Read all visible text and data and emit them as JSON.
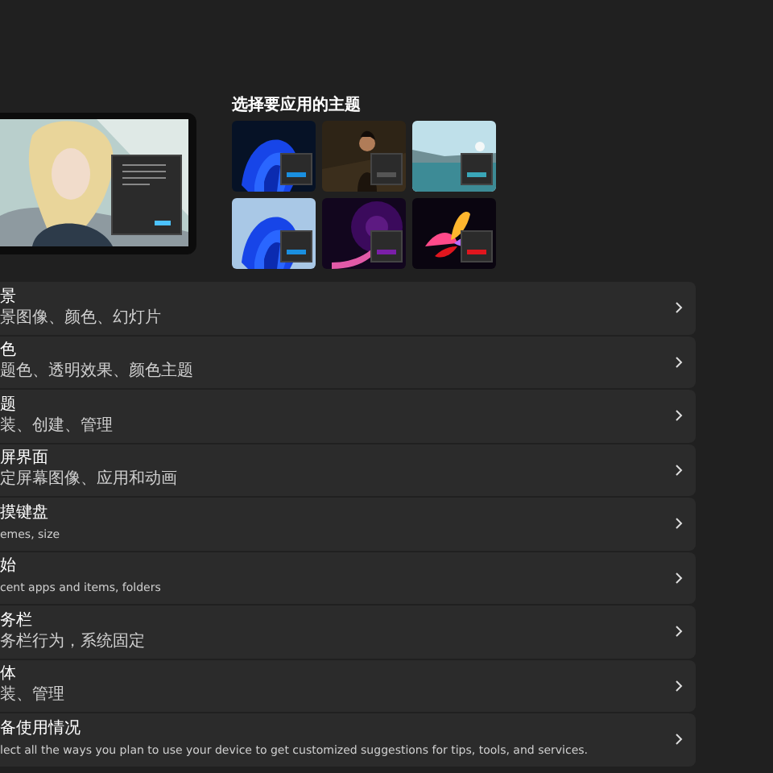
{
  "themes_heading": "选择要应用的主题",
  "themes": [
    {
      "kind": "bloomdark",
      "color": "#1a8fe0"
    },
    {
      "kind": "portrait",
      "color": "#555555"
    },
    {
      "kind": "lake",
      "color": "#3aa6b8"
    },
    {
      "kind": "bloomlight",
      "color": "#1a8fe0"
    },
    {
      "kind": "glow",
      "color": "#7a1fa8"
    },
    {
      "kind": "flower",
      "color": "#e0161e"
    }
  ],
  "settings": [
    {
      "title": "景",
      "subtitle": "景图像、颜色、幻灯片"
    },
    {
      "title": "色",
      "subtitle": "题色、透明效果、颜色主题"
    },
    {
      "title": "题",
      "subtitle": "装、创建、管理"
    },
    {
      "title": "屏界面",
      "subtitle": "定屏幕图像、应用和动画"
    },
    {
      "title": "摸键盘",
      "subtitle": "emes, size"
    },
    {
      "title": "始",
      "subtitle": "cent apps and items, folders"
    },
    {
      "title": "务栏",
      "subtitle": "务栏行为，系统固定"
    },
    {
      "title": "体",
      "subtitle": "装、管理"
    },
    {
      "title": "备使用情况",
      "subtitle": "lect all the ways you plan to use your device to get customized suggestions for tips, tools, and services."
    }
  ]
}
